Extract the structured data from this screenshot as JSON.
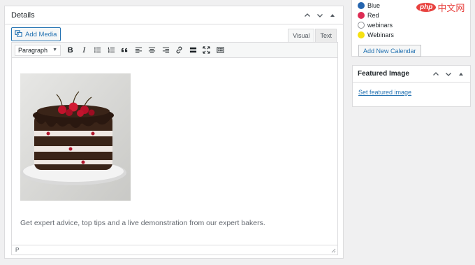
{
  "details": {
    "title": "Details",
    "add_media_label": "Add Media",
    "tabs": [
      "Visual",
      "Text"
    ],
    "format_value": "Paragraph",
    "toolbar_icons": [
      "bold-icon",
      "italic-icon",
      "bulleted-list-icon",
      "numbered-list-icon",
      "blockquote-icon",
      "align-left-icon",
      "align-center-icon",
      "align-right-icon",
      "insert-link-icon",
      "read-more-icon",
      "fullscreen-icon",
      "toolbar-toggle-icon"
    ],
    "toolbar_glyphs": [
      "B",
      "I"
    ],
    "content_text": "Get expert advice, top tips and a live demonstration from our expert bakers.",
    "path_status": "P"
  },
  "calendars": {
    "items": [
      {
        "label": "Blue",
        "color": "#2565ae"
      },
      {
        "label": "Red",
        "color": "#dd2c54"
      },
      {
        "label": "webinars",
        "color": "#ffffff"
      },
      {
        "label": "Webinars",
        "color": "#f6e111"
      }
    ],
    "add_button": "Add New Calendar"
  },
  "featured_image": {
    "title": "Featured Image",
    "link": "Set featured image"
  },
  "watermark": {
    "php": "php",
    "cn": "中文网"
  },
  "colors": {
    "accent": "#2271b1",
    "border": "#dcdcde",
    "background": "#f0f0f1"
  }
}
